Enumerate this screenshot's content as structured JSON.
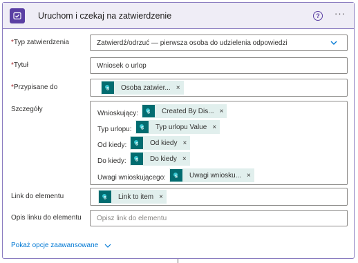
{
  "header": {
    "title": "Uruchom i czekaj na zatwierdzenie",
    "help_glyph": "?",
    "more_glyph": "···"
  },
  "fields": {
    "approval_type": {
      "required": "*",
      "label": "Typ zatwierdzenia",
      "value": "Zatwierdź/odrzuć — pierwsza osoba do udzielenia odpowiedzi"
    },
    "title": {
      "required": "*",
      "label": "Tytuł",
      "value": "Wniosek o urlop"
    },
    "assigned_to": {
      "required": "*",
      "label": "Przypisane do",
      "token": "Osoba zatwier...",
      "remove": "×"
    },
    "details": {
      "label": "Szczegóły",
      "rows": [
        {
          "text": "Wnioskujący:",
          "token": "Created By Dis...",
          "remove": "×"
        },
        {
          "text": "Typ urlopu:",
          "token": "Typ urlopu Value",
          "remove": "×"
        },
        {
          "text": "Od kiedy:",
          "token": "Od kiedy",
          "remove": "×"
        },
        {
          "text": "Do kiedy:",
          "token": "Do kiedy",
          "remove": "×"
        },
        {
          "text": "Uwagi wnioskującego:",
          "token": "Uwagi wniosku...",
          "remove": "×"
        }
      ]
    },
    "item_link": {
      "label": "Link do elementu",
      "token": "Link to item",
      "remove": "×"
    },
    "item_link_description": {
      "label": "Opis linku do elementu",
      "placeholder": "Opisz link do elementu"
    }
  },
  "advanced": {
    "label": "Pokaż opcje zaawansowane"
  },
  "colors": {
    "accent": "#5a3fa3",
    "sharepoint": "#036c70",
    "token_bg": "#e1efed",
    "link": "#0078d4",
    "required": "#a4262c"
  }
}
